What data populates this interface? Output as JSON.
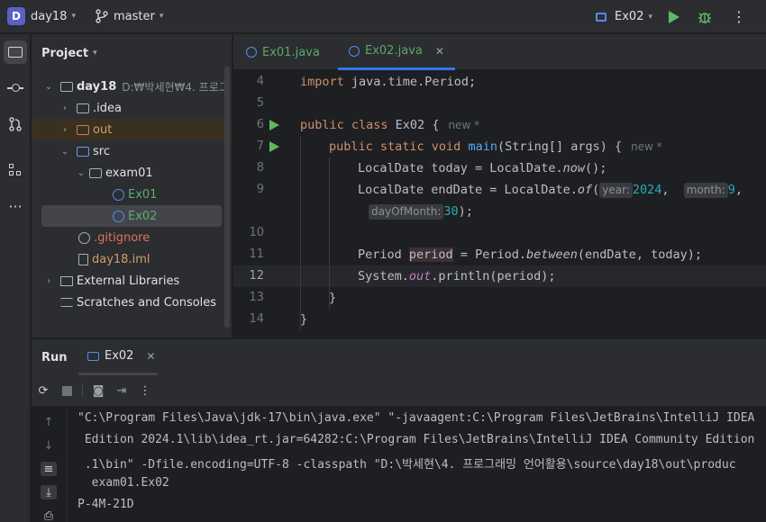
{
  "titlebar": {
    "project_badge": "D",
    "project_name": "day18",
    "branch": "master",
    "run_config": "Ex02"
  },
  "project_panel": {
    "title": "Project",
    "items": [
      {
        "label": "day18",
        "path": "D:₩박세현₩4. 프로그"
      },
      {
        "label": ".idea"
      },
      {
        "label": "out"
      },
      {
        "label": "src"
      },
      {
        "label": "exam01"
      },
      {
        "label": "Ex01"
      },
      {
        "label": "Ex02"
      },
      {
        "label": ".gitignore"
      },
      {
        "label": "day18.iml"
      },
      {
        "label": "External Libraries"
      },
      {
        "label": "Scratches and Consoles"
      }
    ]
  },
  "editor": {
    "tabs": [
      {
        "label": "Ex01.java"
      },
      {
        "label": "Ex02.java"
      }
    ],
    "line_numbers": [
      "4",
      "5",
      "6",
      "7",
      "8",
      "9",
      "10",
      "11",
      "12",
      "13",
      "14"
    ],
    "code": {
      "l4_kw": "import",
      "l4_rest": " java.time.Period;",
      "l6_kw": "public class",
      "l6_rest": " Ex02 {",
      "l7_kw": "public static void",
      "l7_fn": "main",
      "l7_rest": "(String[] args) {",
      "new_star": "new *",
      "l8_a": "LocalDate today = LocalDate.",
      "l8_m": "now",
      "l8_b": "();",
      "l9_a": "LocalDate endDate = LocalDate.",
      "l9_m": "of",
      "l9_b": "(",
      "hint_year": "year:",
      "val_year": "2024",
      "hint_month": "month:",
      "val_month": "9",
      "hint_day": "dayOfMonth:",
      "val_day": "30",
      "l9c_end": ");",
      "l11_a": "Period ",
      "l11_var": "period",
      "l11_b": " = Period.",
      "l11_m": "between",
      "l11_c": "(endDate, today);",
      "l12_a": "System.",
      "l12_out": "out",
      "l12_b": ".println(period);",
      "l13": "}",
      "l14": "}"
    }
  },
  "run_panel": {
    "title": "Run",
    "tab": "Ex02",
    "console": [
      "\"C:\\Program Files\\Java\\jdk-17\\bin\\java.exe\" \"-javaagent:C:\\Program Files\\JetBrains\\IntelliJ IDEA",
      " Edition 2024.1\\lib\\idea_rt.jar=64282:C:\\Program Files\\JetBrains\\IntelliJ IDEA Community Edition",
      " .1\\bin\" -Dfile.encoding=UTF-8 -classpath \"D:\\박세현\\4. 프로그래밍 언어활용\\source\\day18\\out\\produc",
      "  exam01.Ex02",
      "P-4M-21D"
    ]
  }
}
